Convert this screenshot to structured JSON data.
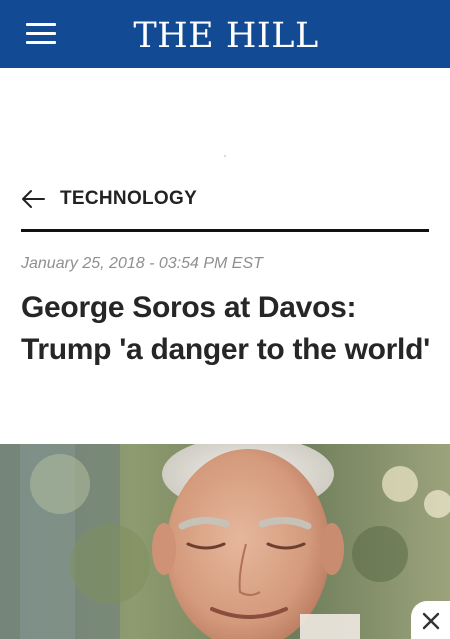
{
  "header": {
    "menu_icon": "hamburger-menu-icon",
    "logo_text": "THE HILL",
    "background_color": "#124A93"
  },
  "section": {
    "back_icon": "arrow-left-icon",
    "label": "TECHNOLOGY"
  },
  "article": {
    "dateline": "January 25, 2018 - 03:54 PM EST",
    "headline": "George Soros at Davos: Trump 'a danger to the world'"
  },
  "overlay": {
    "close_icon": "close-icon"
  }
}
